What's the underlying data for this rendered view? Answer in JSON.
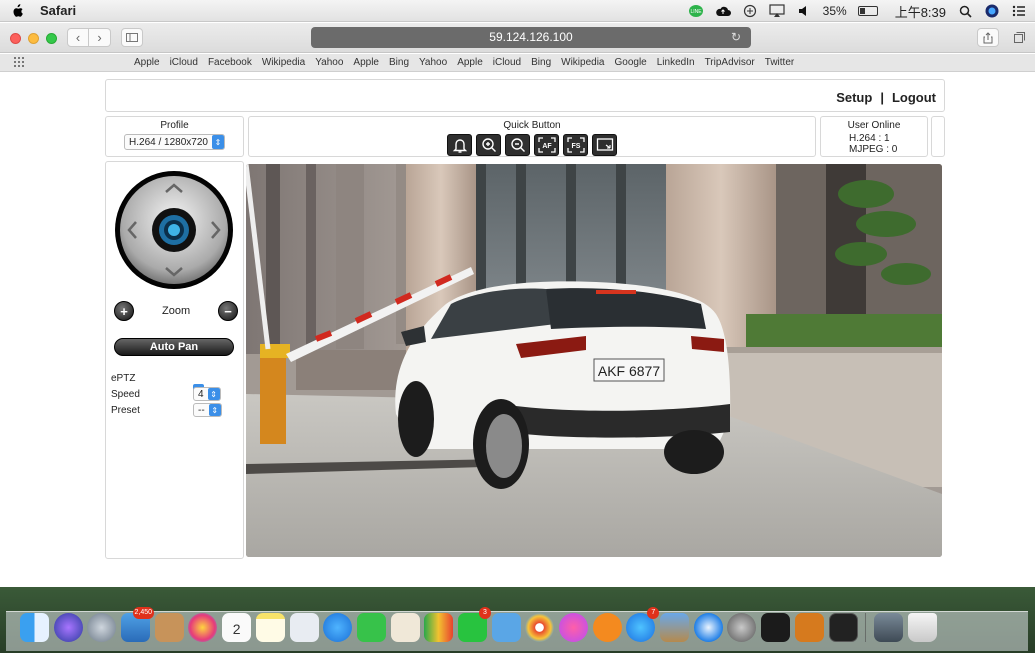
{
  "menubar": {
    "app_name": "Safari",
    "battery_percent": "35%",
    "battery_level": 0.35,
    "clock": "上午8:39",
    "icons": [
      "line-icon",
      "cloud-icon",
      "sync-icon",
      "airplay-icon",
      "volume-icon",
      "battery-icon",
      "spotlight-icon",
      "siri-icon",
      "notification-list-icon"
    ]
  },
  "toolbar": {
    "url": "59.124.126.100"
  },
  "bookmarks": [
    "Apple",
    "iCloud",
    "Facebook",
    "Wikipedia",
    "Yahoo",
    "Apple",
    "Bing",
    "Yahoo",
    "Apple",
    "iCloud",
    "Bing",
    "Wikipedia",
    "Google",
    "LinkedIn",
    "TripAdvisor",
    "Twitter"
  ],
  "header": {
    "setup": "Setup",
    "separator": "|",
    "logout": "Logout"
  },
  "profile": {
    "title": "Profile",
    "selected": "H.264 / 1280x720"
  },
  "quick_button": {
    "title": "Quick Button",
    "buttons": [
      "alarm-bell-icon",
      "zoom-in-icon",
      "zoom-out-icon",
      "auto-focus-icon",
      "focus-icon",
      "fullscreen-icon"
    ],
    "af_label": "AF",
    "fs_label": "FS"
  },
  "user_online": {
    "title": "User Online",
    "h264": "H.264 : 1",
    "mjpeg": "MJPEG : 0"
  },
  "controls": {
    "zoom_label": "Zoom",
    "auto_pan": "Auto Pan",
    "eptz_label": "ePTZ",
    "speed_label": "Speed",
    "speed_value": "4",
    "preset_label": "Preset",
    "preset_value": "--"
  },
  "video": {
    "plate": "AKF 6877"
  },
  "dock": {
    "badges": {
      "appstore_updates": "2,450",
      "line": "3",
      "appstore": "7"
    },
    "calendar_day": "2"
  }
}
